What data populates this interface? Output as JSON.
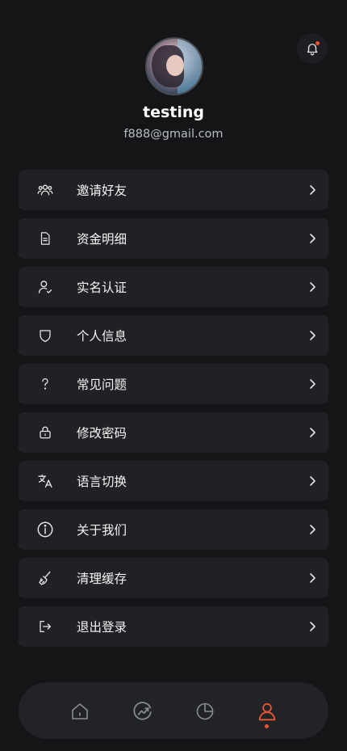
{
  "profile": {
    "username": "testing",
    "email": "f888@gmail.com"
  },
  "notifications": {
    "icon": "bell-icon",
    "has_unread": true
  },
  "menu": [
    {
      "label": "邀请好友",
      "icon": "users-icon"
    },
    {
      "label": "资金明细",
      "icon": "document-icon"
    },
    {
      "label": "实名认证",
      "icon": "user-check-icon"
    },
    {
      "label": "个人信息",
      "icon": "shield-icon"
    },
    {
      "label": "常见问题",
      "icon": "question-icon"
    },
    {
      "label": "修改密码",
      "icon": "lock-icon"
    },
    {
      "label": "语言切换",
      "icon": "translate-icon"
    },
    {
      "label": "关于我们",
      "icon": "info-icon"
    },
    {
      "label": "清理缓存",
      "icon": "brush-icon"
    },
    {
      "label": "退出登录",
      "icon": "logout-icon"
    }
  ],
  "tabbar": {
    "items": [
      {
        "name": "home",
        "icon": "home-icon"
      },
      {
        "name": "market",
        "icon": "trend-icon"
      },
      {
        "name": "assets",
        "icon": "pie-chart-icon"
      },
      {
        "name": "profile",
        "icon": "user-icon",
        "active": true
      }
    ]
  },
  "colors": {
    "background": "#141517",
    "card": "#202124",
    "accent": "#e8552f",
    "text": "#f4f4f4",
    "muted": "#b9bcc2"
  }
}
